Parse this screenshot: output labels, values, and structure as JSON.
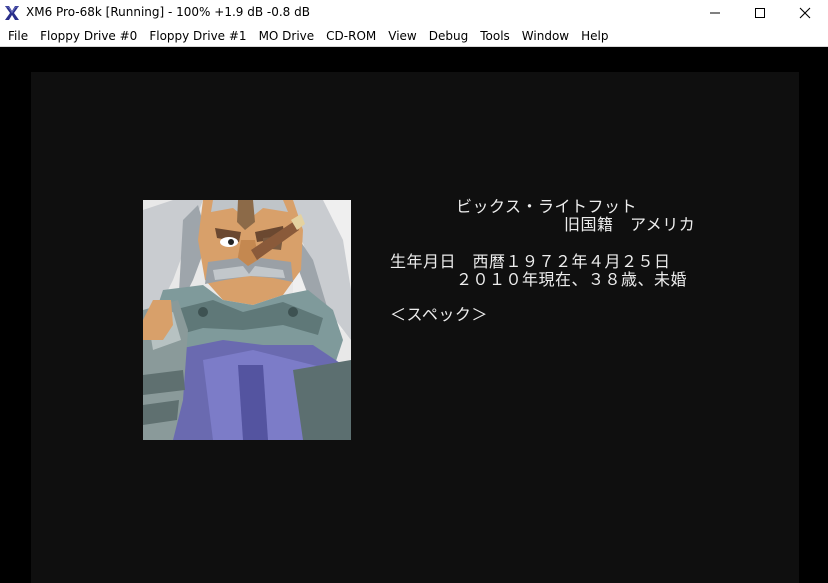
{
  "window": {
    "title": "XM6 Pro-68k [Running] - 100% +1.9 dB  -0.8 dB",
    "app_icon": "xm6-x-logo-icon",
    "controls": [
      "minimize-icon",
      "maximize-icon",
      "close-icon"
    ]
  },
  "menubar": {
    "items": [
      "File",
      "Floppy Drive #0",
      "Floppy Drive #1",
      "MO Drive",
      "CD-ROM",
      "View",
      "Debug",
      "Tools",
      "Window",
      "Help"
    ]
  },
  "screen": {
    "name": "ビックス・ライトフット",
    "nationality": "旧国籍　アメリカ",
    "birth": "生年月日　西暦１９７２年４月２５日",
    "age": "２０１０年現在、３８歳、未婚",
    "spec": "＜スペック＞"
  },
  "colors": {
    "titlebar_bg": "#ffffff",
    "emulator_bg": "#000000",
    "screen_bg": "#0f0f0f",
    "screen_text": "#ededed"
  }
}
